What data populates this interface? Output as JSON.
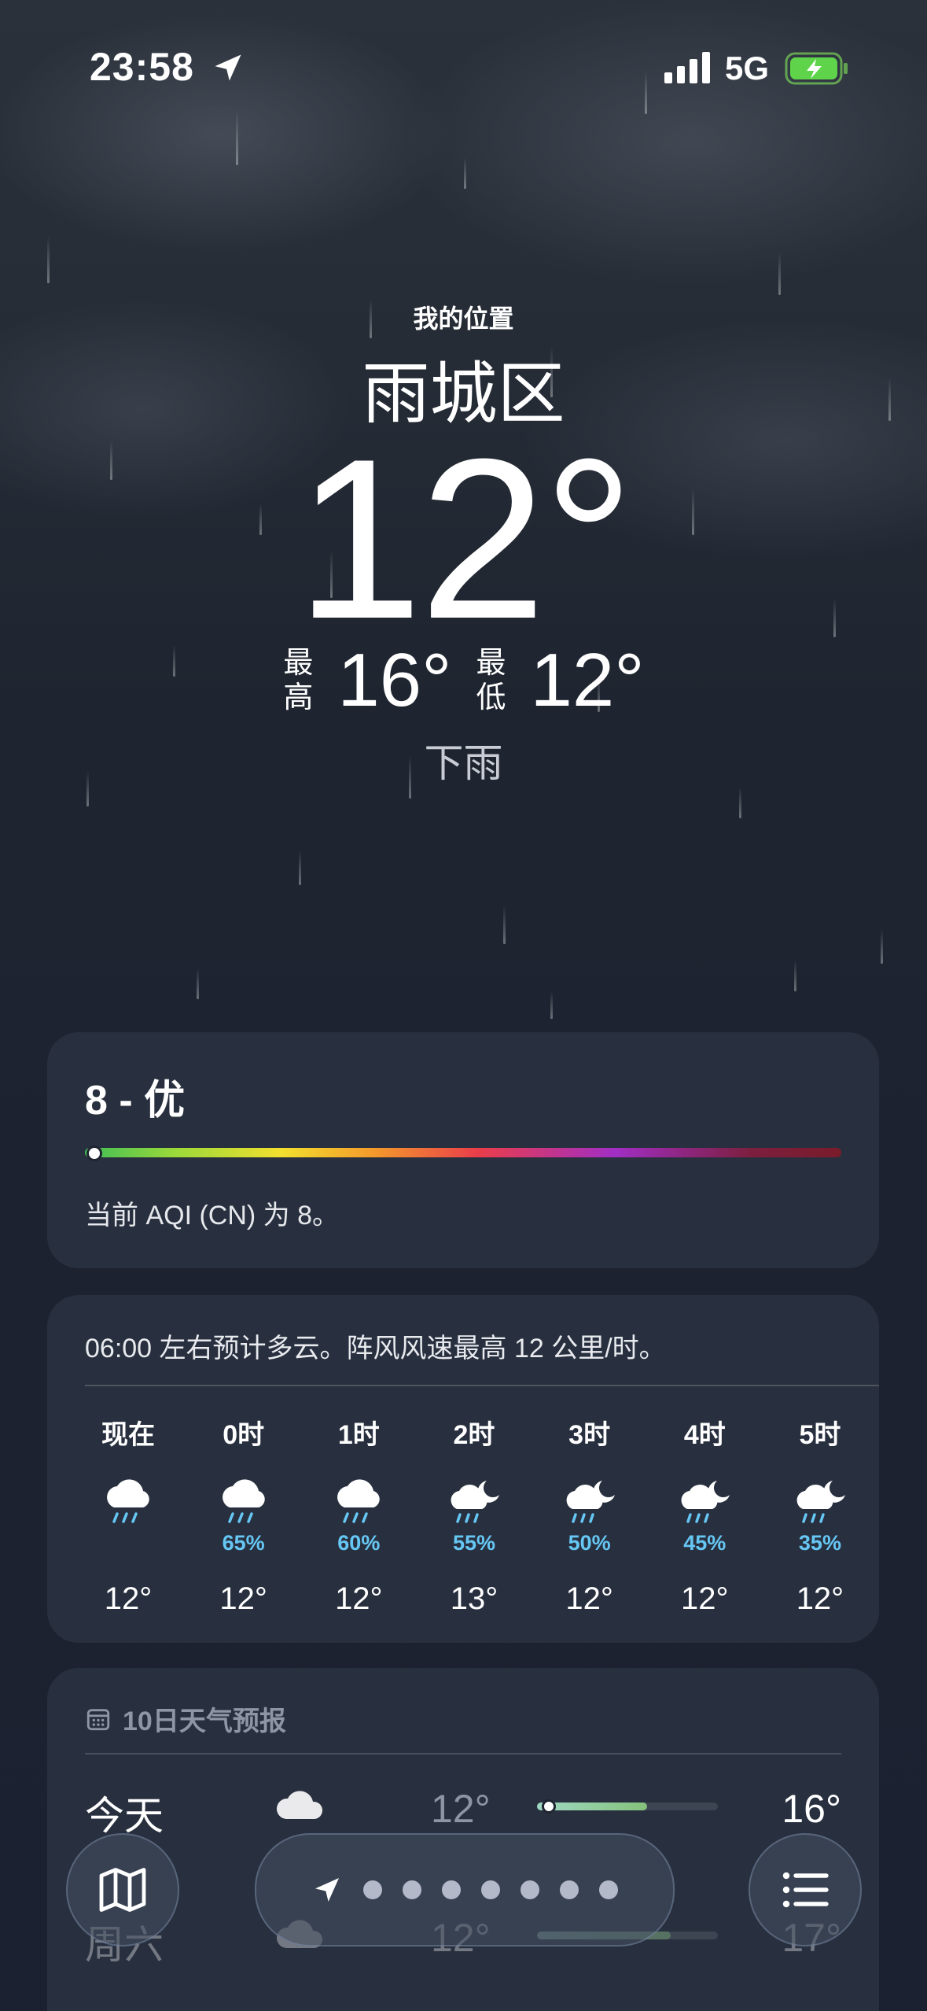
{
  "status": {
    "time": "23:58",
    "network": "5G"
  },
  "header": {
    "my_location": "我的位置",
    "city": "雨城区",
    "temperature": "12°",
    "high_label": "最高",
    "high": "16°",
    "low_label": "最低",
    "low": "12°",
    "condition": "下雨"
  },
  "aqi": {
    "value_label": "8 - 优",
    "description": "当前 AQI (CN) 为 8。",
    "level": 0.01
  },
  "hourly": {
    "summary": "06:00 左右预计多云。阵风风速最高 12 公里/时。",
    "items": [
      {
        "label": "现在",
        "icon": "cloud-rain-icon",
        "precip": "",
        "temp": "12°"
      },
      {
        "label": "0时",
        "icon": "cloud-rain-icon",
        "precip": "65%",
        "temp": "12°"
      },
      {
        "label": "1时",
        "icon": "cloud-rain-icon",
        "precip": "60%",
        "temp": "12°"
      },
      {
        "label": "2时",
        "icon": "cloud-moon-rain-icon",
        "precip": "55%",
        "temp": "13°"
      },
      {
        "label": "3时",
        "icon": "cloud-moon-rain-icon",
        "precip": "50%",
        "temp": "12°"
      },
      {
        "label": "4时",
        "icon": "cloud-moon-rain-icon",
        "precip": "45%",
        "temp": "12°"
      },
      {
        "label": "5时",
        "icon": "cloud-moon-rain-icon",
        "precip": "35%",
        "temp": "12°"
      }
    ]
  },
  "tenday": {
    "title": "10日天气预报",
    "rows": [
      {
        "day": "今天",
        "icon": "cloud-icon",
        "low": "12°",
        "high": "16°"
      },
      {
        "day": "周六",
        "icon": "cloud-icon",
        "low": "12°",
        "high": "17°"
      }
    ]
  },
  "colors": {
    "precip": "#66c7f4",
    "background": "#1f2530"
  }
}
